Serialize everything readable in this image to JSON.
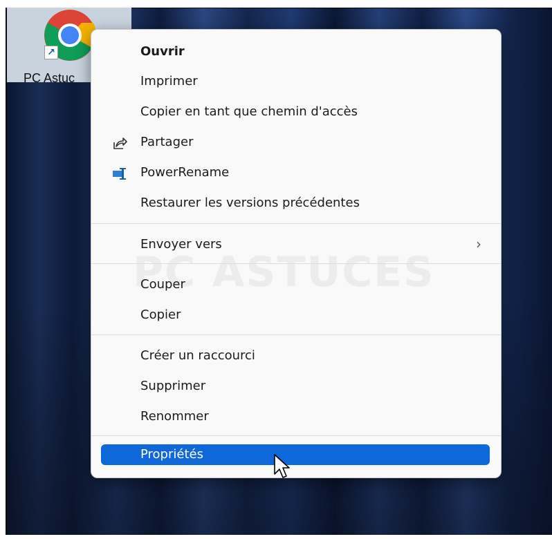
{
  "desktop": {
    "icon_label": "PC Astuc",
    "icon_name": "chrome-icon"
  },
  "menu": {
    "items": [
      {
        "label": "Ouvrir"
      },
      {
        "label": "Imprimer"
      },
      {
        "label": "Copier en tant que chemin d'accès"
      },
      {
        "label": "Partager",
        "icon": "share-icon"
      },
      {
        "label": "PowerRename",
        "icon": "powerrename-icon"
      },
      {
        "label": "Restaurer les versions précédentes"
      },
      {
        "label": "Envoyer vers",
        "submenu": true
      },
      {
        "label": "Couper"
      },
      {
        "label": "Copier"
      },
      {
        "label": "Créer un raccourci"
      },
      {
        "label": "Supprimer"
      },
      {
        "label": "Renommer"
      },
      {
        "label": "Propriétés",
        "selected": true
      }
    ],
    "watermark": "PC ASTUCES",
    "selection_color": "#0f68d9"
  }
}
